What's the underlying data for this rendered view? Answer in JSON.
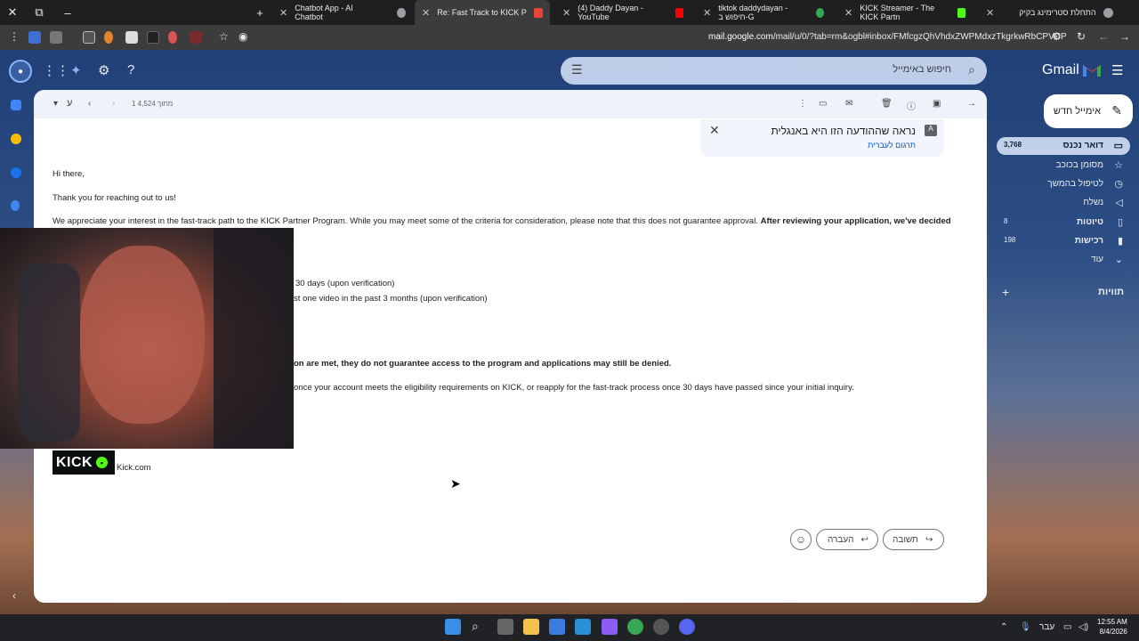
{
  "browser": {
    "tabs": [
      {
        "title": "Chatbot App - AI Chatbot",
        "color": "#e8eaed"
      },
      {
        "title": "Re: Fast Track to KICK Partner P",
        "color": "#ea4335",
        "active": true
      },
      {
        "title": "(4) Daddy Dayan - YouTube",
        "color": "#ff0000"
      },
      {
        "title": "tiktok daddydayan - חיפוש ב-G",
        "color": "#34a853"
      },
      {
        "title": "KICK Streamer - The KICK Partn",
        "color": "#53fc18"
      },
      {
        "title": "התחלת סטרימינג בקיק",
        "color": "#e8eaed"
      }
    ],
    "url_host": "mail.google.com",
    "url_path": "/mail/u/0/?tab=rm&ogbl#inbox/FMfcgzQhVhdxZWPMdxzTkgrkwRbCPVCP"
  },
  "gmail": {
    "logo_text": "Gmail",
    "search_placeholder": "חיפוש באימייל",
    "compose_label": "אימייל חדש",
    "nav": [
      {
        "label": "דואר נכנס",
        "count": "3,768",
        "icon": "inbox-icon"
      },
      {
        "label": "מסומן בכוכב",
        "count": "",
        "icon": "star-icon"
      },
      {
        "label": "לטיפול בהמשך",
        "count": "",
        "icon": "clock-icon"
      },
      {
        "label": "נשלח",
        "count": "",
        "icon": "send-icon"
      },
      {
        "label": "טיוטות",
        "count": "8",
        "icon": "draft-icon"
      },
      {
        "label": "רכישות",
        "count": "198",
        "icon": "purchases-icon"
      },
      {
        "label": "עוד",
        "count": "",
        "icon": "chevron-down-icon"
      }
    ],
    "labels_header": "תוויות"
  },
  "message": {
    "counter": "1 מתוך 4,524",
    "lang_label": "ע",
    "translate_notice": "נראה שההודעה הזו היא באנגלית",
    "translate_link": "תרגום לעברית",
    "greeting": "Hi there,",
    "thanks": "Thank you for reaching out to us!",
    "para1_normal": "We appreciate your interest in the fast-track path to the KICK Partner Program. While you may meet some of the criteria for consideration, please note that this does not guarantee approval. ",
    "para1_bold": "After reviewing your application, we've decided",
    "crit1": "30 days (upon verification)",
    "crit2": "st one video in the past 3 months (upon verification)",
    "bold_line": "on are met, they do not guarantee access to the program and applications may still be denied.",
    "reapply": "once your account meets the eligibility requirements on KICK, or reapply for the fast-track process once 30 days have passed since your initial inquiry.",
    "kick_logo_text": "KICK",
    "kick_link": "Kick.com",
    "reply_label": "תשובה",
    "forward_label": "העברה"
  },
  "taskbar": {
    "lang": "עבר",
    "time": "12:55 AM",
    "date": "8/4/2026"
  }
}
